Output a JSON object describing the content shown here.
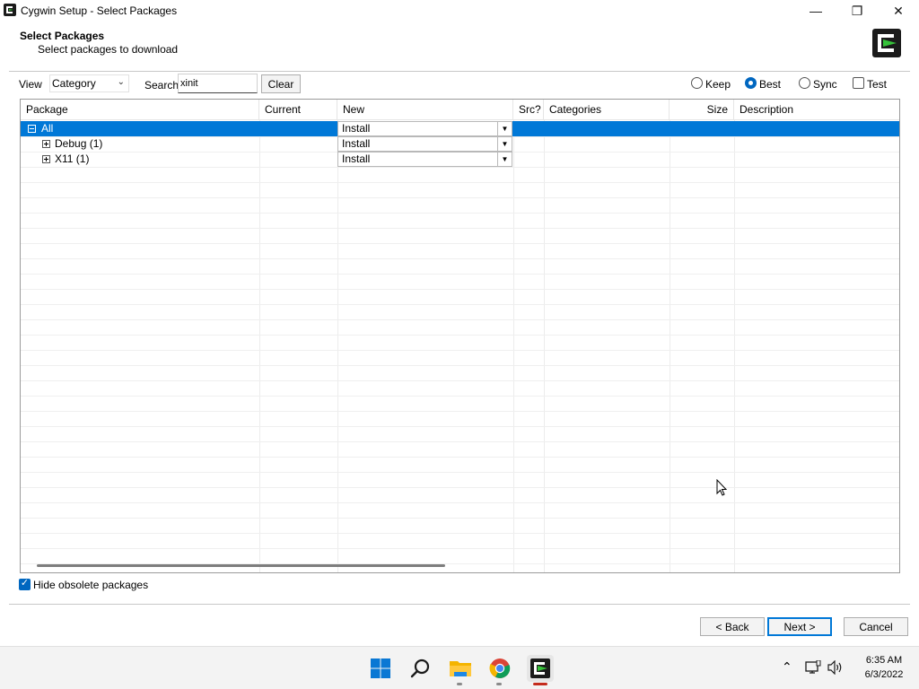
{
  "window": {
    "title": "Cygwin Setup - Select Packages",
    "minimize_glyph": "—",
    "maximize_glyph": "❐",
    "close_glyph": "✕"
  },
  "header": {
    "title": "Select Packages",
    "subtitle": "Select packages to download"
  },
  "toolbar": {
    "view_label": "View",
    "view_value": "Category",
    "search_label": "Search",
    "search_value": "xinit",
    "clear_label": "Clear",
    "options": [
      {
        "label": "Keep",
        "selected": false
      },
      {
        "label": "Best",
        "selected": true
      },
      {
        "label": "Sync",
        "selected": false
      }
    ],
    "test_label": "Test"
  },
  "list": {
    "columns": [
      "Package",
      "Current",
      "New",
      "Src?",
      "Categories",
      "Size",
      "Description"
    ],
    "rows": [
      {
        "package": "All",
        "new": "Install",
        "expander": "minus",
        "selected": true
      },
      {
        "package": "Debug (1)",
        "new": "Install",
        "expander": "plus",
        "selected": false
      },
      {
        "package": "X11 (1)",
        "new": "Install",
        "expander": "plus",
        "selected": false
      }
    ]
  },
  "footer": {
    "hide_obsolete_label": "Hide obsolete packages",
    "hide_obsolete_checked": true,
    "back_label": "< Back",
    "next_label": "Next >",
    "cancel_label": "Cancel"
  },
  "taskbar": {
    "time": "6:35 AM",
    "date": "6/3/2022",
    "icons": [
      "windows-start-icon",
      "search-icon",
      "file-explorer-icon",
      "chrome-icon",
      "cygwin-setup-icon"
    ]
  },
  "colors": {
    "accent": "#0078d7",
    "selection": "#0078d7"
  }
}
